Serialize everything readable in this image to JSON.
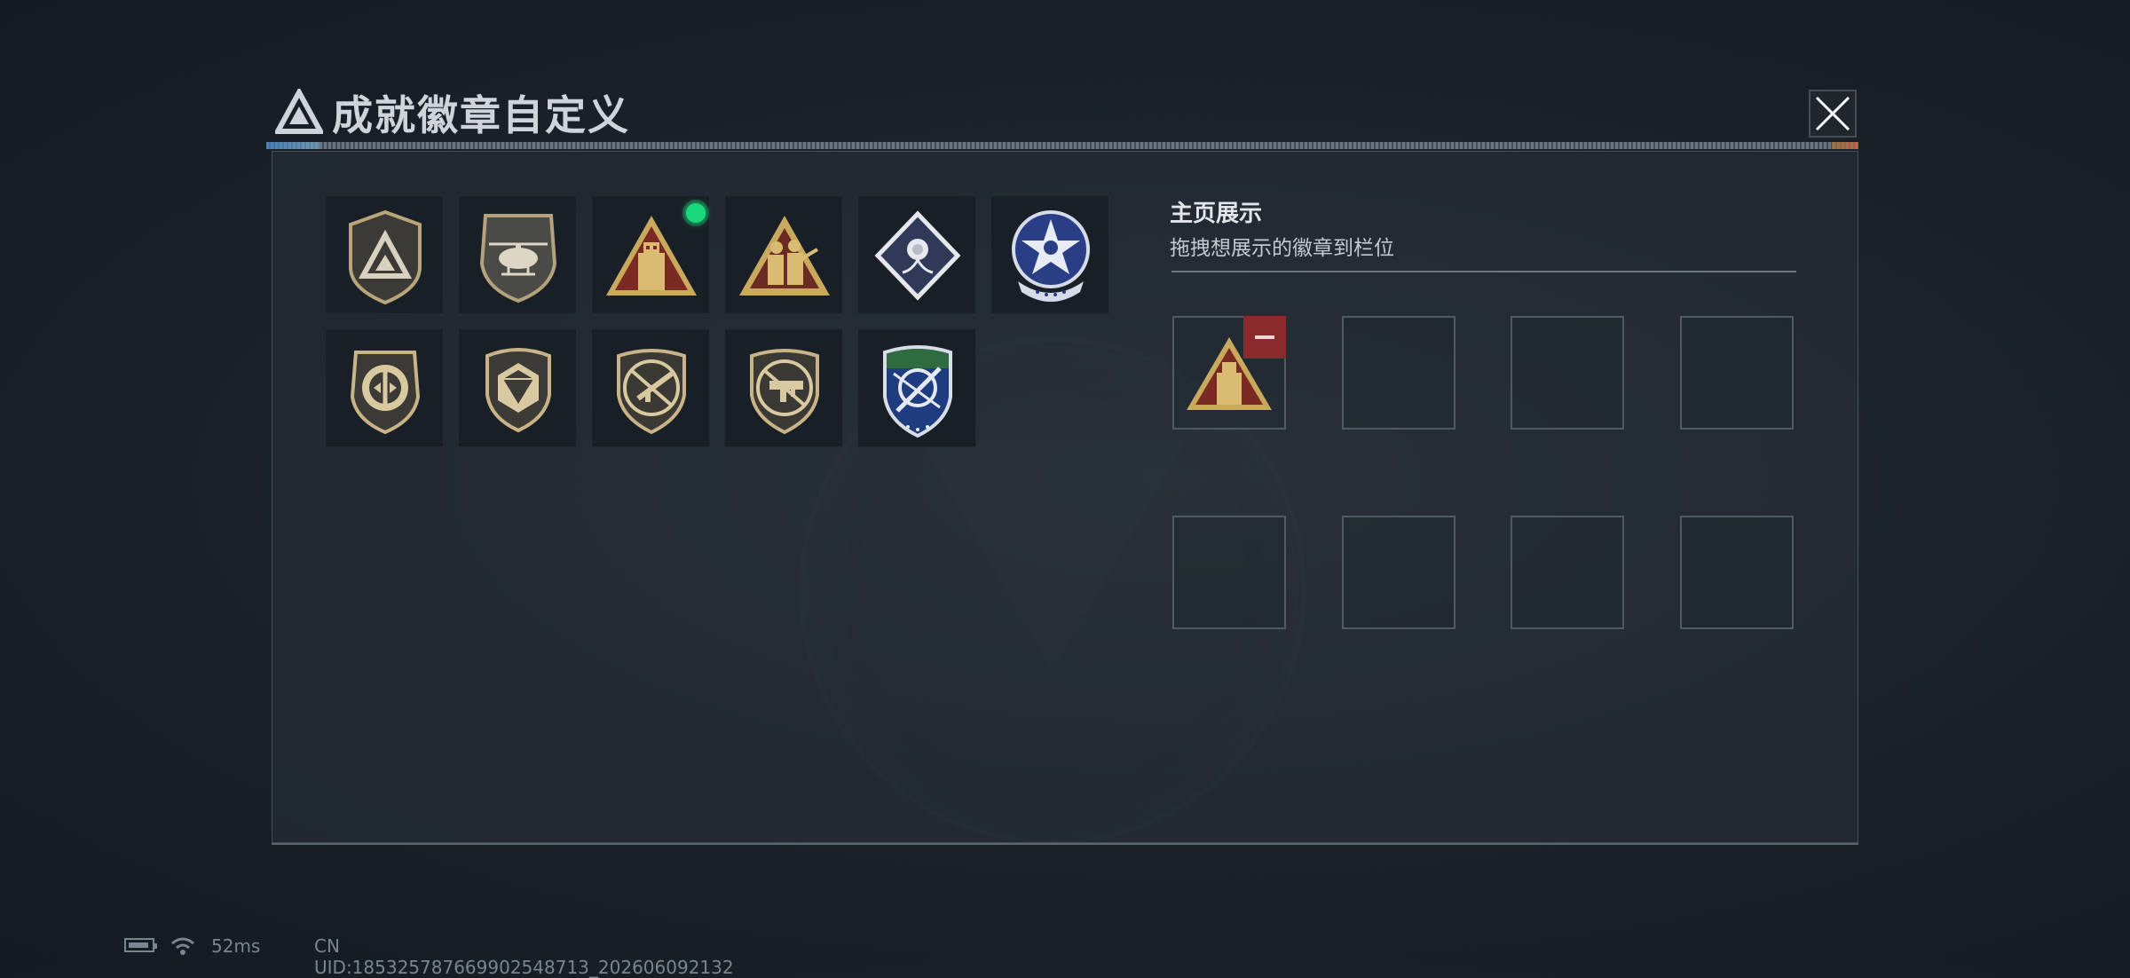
{
  "header": {
    "title": "成就徽章自定义",
    "tag": "...nk.l1.1..."
  },
  "badges": [
    {
      "icon": "triangle-shield-badge-icon"
    },
    {
      "icon": "helicopter-badge-icon"
    },
    {
      "icon": "usb-triangle-badge-icon",
      "new": true
    },
    {
      "icon": "soldiers-triangle-badge-icon"
    },
    {
      "icon": "rose-diamond-badge-icon"
    },
    {
      "icon": "star-wings-medal-icon"
    },
    {
      "icon": "split-circle-shield-icon"
    },
    {
      "icon": "dice-shield-icon"
    },
    {
      "icon": "rifle-shield-icon"
    },
    {
      "icon": "smg-shield-icon"
    },
    {
      "icon": "crosshair-knife-shield-icon"
    }
  ],
  "display": {
    "title": "主页展示",
    "hint": "拖拽想展示的徽章到栏位",
    "slots": [
      {
        "badge": "usb-triangle-badge-icon"
      },
      {
        "badge": null
      },
      {
        "badge": null
      },
      {
        "badge": null
      },
      {
        "badge": null
      },
      {
        "badge": null
      },
      {
        "badge": null
      },
      {
        "badge": null
      }
    ]
  },
  "status": {
    "ping": "52ms",
    "uid": "CN UID:185325787669902548713_202606092132"
  },
  "colors": {
    "new_indicator": "#19d97a",
    "remove": "#8a2a2c",
    "gold": "#c8a95e"
  }
}
